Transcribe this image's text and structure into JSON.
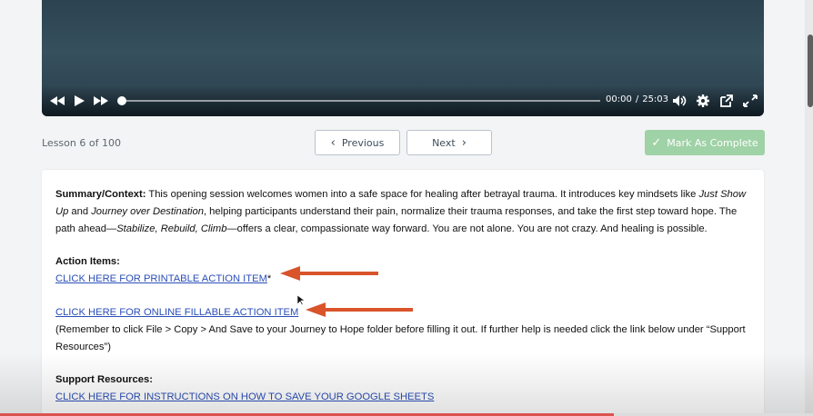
{
  "video": {
    "current_time": "00:00",
    "separator": "/",
    "duration": "25:03",
    "progress": 0.0,
    "icons": [
      "rewind-icon",
      "play-icon",
      "fast-forward-icon",
      "volume-icon",
      "settings-gear-icon",
      "open-external-icon",
      "fullscreen-icon"
    ]
  },
  "lesson": {
    "counter": "Lesson 6 of 100",
    "previous_label": "Previous",
    "next_label": "Next",
    "complete_label": "Mark As Complete"
  },
  "content": {
    "summary_label": "Summary/Context:",
    "summary_text_1": " This opening session welcomes women into a safe space for healing after betrayal trauma. It introduces key mindsets like ",
    "summary_em_1": "Just Show Up",
    "summary_text_2": " and ",
    "summary_em_2": "Journey over Destination",
    "summary_text_3": ", helping participants understand their pain, normalize their trauma responses, and take the first step toward hope. The path ahead—",
    "summary_em_3": "Stabilize, Rebuild, Climb",
    "summary_text_4": "—offers a clear, compassionate way forward. You are not alone. You are not crazy. And healing is possible.",
    "action_items_label": "Action Items:",
    "printable_link": "CLICK HERE FOR PRINTABLE ACTION ITEM",
    "printable_suffix": "*",
    "fillable_link": "CLICK HERE FOR ONLINE FILLABLE ACTION ITEM",
    "fillable_note": "(Remember to click File > Copy > And Save to your Journey to Hope folder before filling it out. If further help is needed click the link below under “Support Resources”)",
    "support_label": "Support Resources:",
    "google_sheets_link": "CLICK HERE FOR INSTRUCTIONS ON HOW TO SAVE YOUR GOOGLE SHEETS"
  },
  "colors": {
    "accent_arrow": "#d9542b",
    "link": "#2b4fb8",
    "complete_button": "#9fd2a6"
  }
}
